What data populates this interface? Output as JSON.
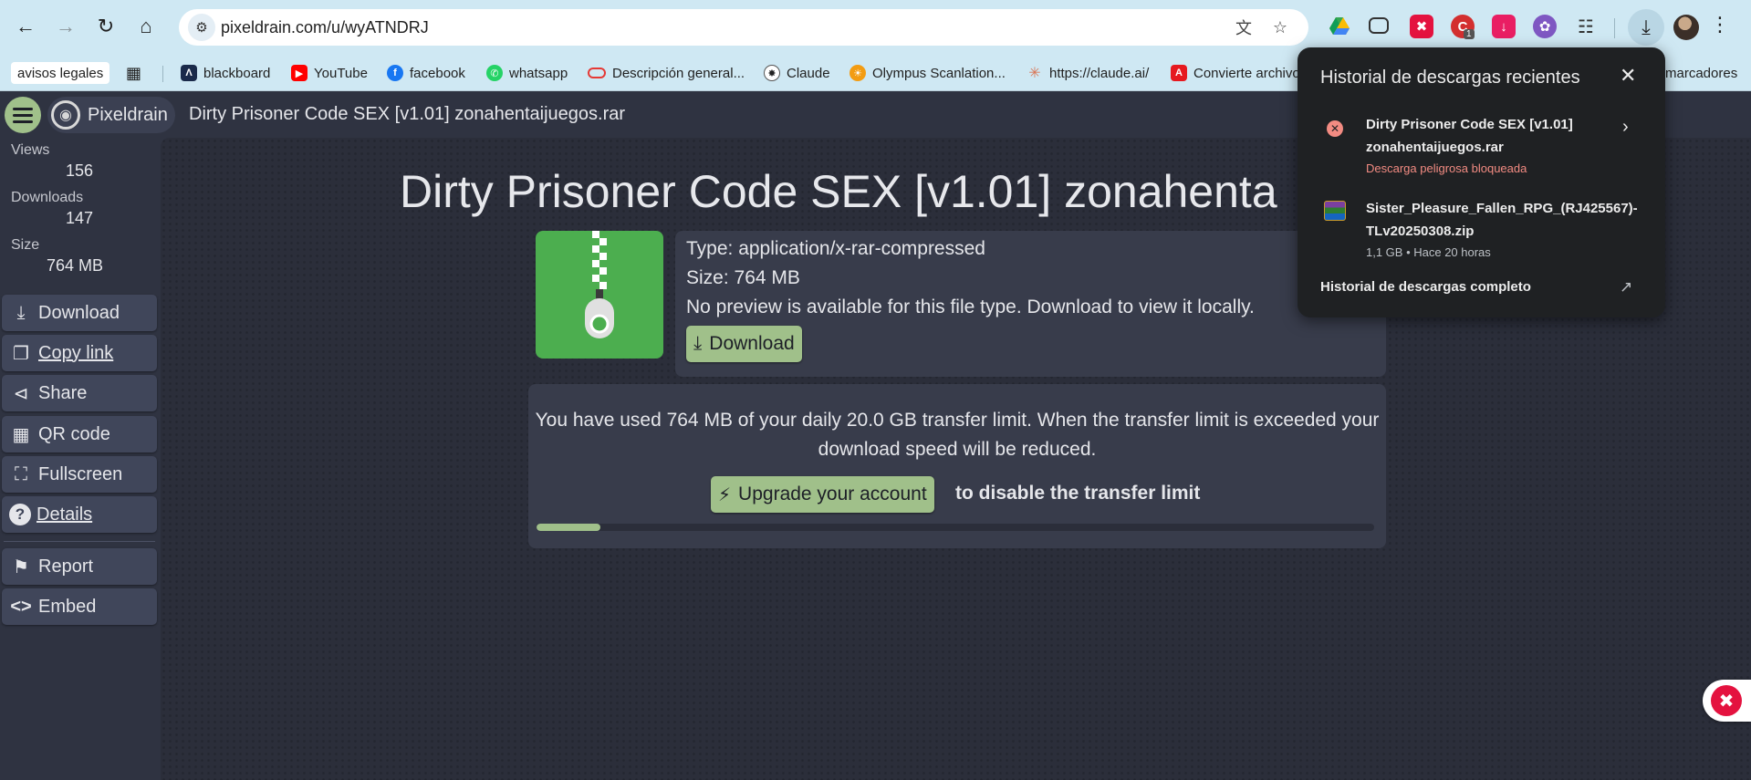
{
  "browser": {
    "url": "pixeldrain.com/u/wyATNDRJ",
    "bookmarks": [
      {
        "label": "avisos legales",
        "icon": "none"
      },
      {
        "label": "",
        "icon": "apps-grid-icon"
      },
      {
        "label": "blackboard",
        "icon": "blackboard-icon"
      },
      {
        "label": "YouTube",
        "icon": "youtube-icon"
      },
      {
        "label": "facebook",
        "icon": "facebook-icon"
      },
      {
        "label": "whatsapp",
        "icon": "whatsapp-icon"
      },
      {
        "label": "Descripción general...",
        "icon": "oval-icon"
      },
      {
        "label": "Claude",
        "icon": "openai-icon"
      },
      {
        "label": "Olympus Scanlation...",
        "icon": "olympus-icon"
      },
      {
        "label": "https://claude.ai/",
        "icon": "claude-icon"
      },
      {
        "label": "Convierte archivo",
        "icon": "adobe-icon"
      }
    ],
    "bookmarks_overflow": "marcadores",
    "extension_badge": "1"
  },
  "app": {
    "brand": "Pixeldrain",
    "file_title": "Dirty Prisoner Code SEX [v1.01] zonahentaijuegos.rar"
  },
  "stats": {
    "views_label": "Views",
    "views_value": "156",
    "downloads_label": "Downloads",
    "downloads_value": "147",
    "size_label": "Size",
    "size_value": "764 MB"
  },
  "sidebar_buttons": {
    "download": "Download",
    "copy_link": "Copy link",
    "share": "Share",
    "qr_code": "QR code",
    "fullscreen": "Fullscreen",
    "details": "Details",
    "report": "Report",
    "embed": "Embed"
  },
  "main": {
    "title": "Dirty Prisoner Code SEX [v1.01] zonahenta",
    "type_line": "Type: application/x-rar-compressed",
    "size_line": "Size: 764 MB",
    "preview_line": "No preview is available for this file type. Download to view it locally.",
    "download_button": "Download",
    "limit_text": "You have used 764 MB of your daily 20.0 GB transfer limit. When the transfer limit is exceeded your download speed will be reduced.",
    "upgrade_button": "Upgrade your account",
    "upgrade_suffix": "to disable the transfer limit",
    "transfer_used_fraction": 0.076
  },
  "downloads_popup": {
    "title": "Historial de descargas recientes",
    "items": [
      {
        "name_line1": "Dirty Prisoner Code SEX [v1.01]",
        "name_line2": "zonahentaijuegos.rar",
        "status": "Descarga peligrosa bloqueada",
        "status_color": "#f28b82",
        "icon": "blocked-icon"
      },
      {
        "name_line1": "Sister_Pleasure_Fallen_RPG_(RJ425567)-",
        "name_line2": "TLv20250308.zip",
        "status": "1,1 GB • Hace 20 horas",
        "status_color": "#bdc1c6",
        "icon": "winrar-icon"
      }
    ],
    "footer": "Historial de descargas completo"
  },
  "colors": {
    "accent_green": "#a0c08a",
    "page_bg": "#2f3341",
    "panel_bg": "#383c4b",
    "chrome_bg": "#cfe8f3"
  }
}
